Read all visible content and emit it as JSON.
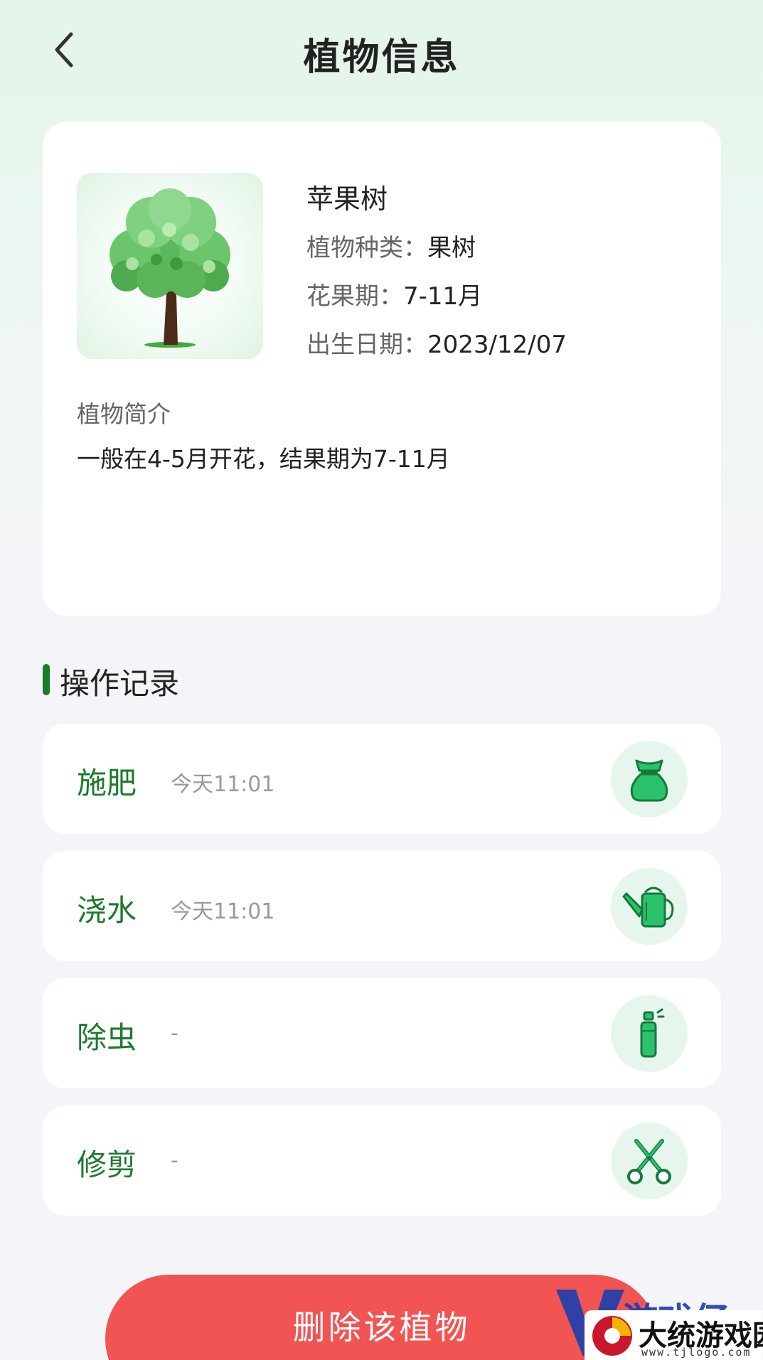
{
  "header": {
    "title": "植物信息"
  },
  "plant": {
    "name": "苹果树",
    "type_label": "植物种类：",
    "type_value": "果树",
    "season_label": "花果期：",
    "season_value": "7-11月",
    "birth_label": "出生日期：",
    "birth_value": "2023/12/07",
    "intro_title": "植物简介",
    "intro_text": "一般在4-5月开花，结果期为7-11月"
  },
  "records": {
    "title": "操作记录",
    "items": [
      {
        "name": "施肥",
        "time": "今天11:01",
        "icon": "fertilizer-bag-icon"
      },
      {
        "name": "浇水",
        "time": "今天11:01",
        "icon": "watering-can-icon"
      },
      {
        "name": "除虫",
        "time": "-",
        "icon": "spray-bottle-icon"
      },
      {
        "name": "修剪",
        "time": "-",
        "icon": "scissors-icon"
      }
    ]
  },
  "actions": {
    "delete_label": "删除该植物"
  },
  "watermark": {
    "text": "游戏仔",
    "brand": "大统游戏园",
    "url": "www.tjlogo.com"
  },
  "colors": {
    "accent_green": "#1c7a2c",
    "icon_green": "#2bc26b",
    "icon_bg": "#e6f6ec",
    "delete_red": "#f25353"
  }
}
